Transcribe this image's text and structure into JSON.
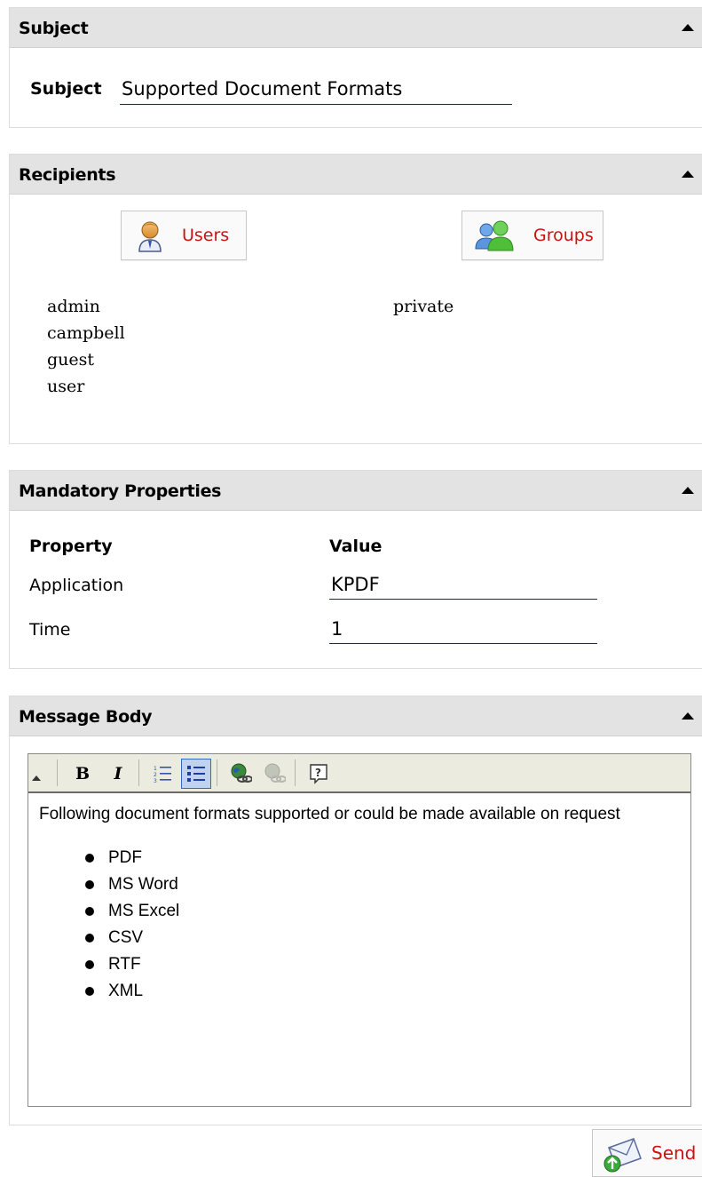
{
  "subject_panel": {
    "title": "Subject",
    "field_label": "Subject",
    "field_value": "Supported Document Formats"
  },
  "recipients_panel": {
    "title": "Recipients",
    "users_button": "Users",
    "groups_button": "Groups",
    "users": [
      "admin",
      "campbell",
      "guest",
      "user"
    ],
    "groups": [
      "private"
    ]
  },
  "properties_panel": {
    "title": "Mandatory Properties",
    "col_property": "Property",
    "col_value": "Value",
    "rows": [
      {
        "name": "Application",
        "value": "KPDF"
      },
      {
        "name": "Time",
        "value": "1"
      }
    ]
  },
  "body_panel": {
    "title": "Message Body",
    "toolbar": [
      "bold-icon",
      "italic-icon",
      "ordered-list-icon",
      "unordered-list-icon",
      "insert-link-icon",
      "remove-link-icon",
      "help-icon"
    ],
    "intro": "Following document formats supported or could be made available on request",
    "items": [
      "PDF",
      "MS Word",
      "MS Excel",
      "CSV",
      "RTF",
      "XML"
    ]
  },
  "send_button": "Send",
  "colors": {
    "header_bg": "#e3e3e3",
    "link_red": "#cc1111",
    "toolbar_bg": "#ecebe0",
    "active_btn": "#c1d2ee"
  }
}
